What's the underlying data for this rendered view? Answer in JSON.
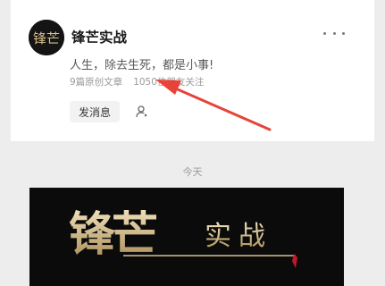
{
  "profile": {
    "account_name": "锋芒实战",
    "signature": "人生，除去生死，都是小事!",
    "article_count_text": "9篇原创文章",
    "followers_text": "1050位朋友关注",
    "avatar_text": "锋芒",
    "message_button_label": "发消息",
    "more_icon": "more-dots-icon",
    "user_icon": "person-outline-icon"
  },
  "feed": {
    "date_label": "今天",
    "cover": {
      "title_large": "锋芒",
      "title_small": "实战",
      "text_color": "#d9c49a",
      "accent_color": "#c0182a"
    }
  },
  "annotation": {
    "arrow_color": "#e8433a"
  }
}
